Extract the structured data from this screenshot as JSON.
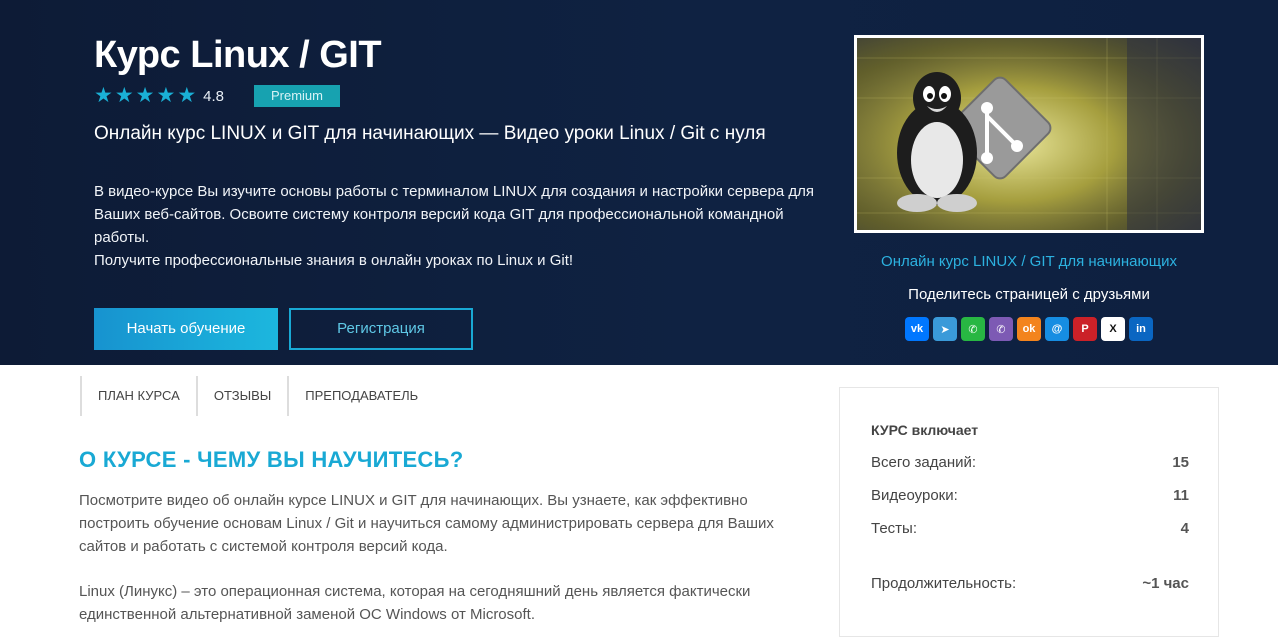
{
  "hero": {
    "title": "Курс Linux / GIT",
    "rating_value": "4.8",
    "premium_label": "Premium",
    "subtitle": "Онлайн курс LINUX и GIT для начинающих — Видео уроки Linux / Git с нуля",
    "description": "В видео-курсе Вы изучите основы работы с терминалом LINUX для создания и настройки сервера для Ваших веб-сайтов. Освоите систему контроля версий кода GIT для профессиональной командной работы.",
    "description2": "Получите профессиональные знания в онлайн уроках по Linux и Git!",
    "start_button": "Начать обучение",
    "register_button": "Регистрация"
  },
  "sidebar": {
    "image_link": "Онлайн курс LINUX / GIT для начинающих",
    "share_label": "Поделитесь страницей с друзьями",
    "share_buttons": [
      {
        "name": "vk",
        "glyph": "vk",
        "color": "#0077ff"
      },
      {
        "name": "telegram",
        "glyph": "➤",
        "color": "#3a9ad9"
      },
      {
        "name": "whatsapp",
        "glyph": "✆",
        "color": "#28b743"
      },
      {
        "name": "viber",
        "glyph": "✆",
        "color": "#7d5ab4"
      },
      {
        "name": "odnoklassniki",
        "glyph": "ok",
        "color": "#f3841d"
      },
      {
        "name": "moimir",
        "glyph": "@",
        "color": "#168de2"
      },
      {
        "name": "pinterest",
        "glyph": "P",
        "color": "#cb2128"
      },
      {
        "name": "x",
        "glyph": "X",
        "color": "#ffffff"
      },
      {
        "name": "linkedin",
        "glyph": "in",
        "color": "#0a66c2"
      }
    ]
  },
  "tabs": [
    "ПЛАН КУРСА",
    "ОТЗЫВЫ",
    "ПРЕПОДАВАТЕЛЬ"
  ],
  "about": {
    "heading": "О КУРСЕ - ЧЕМУ ВЫ НАУЧИТЕСЬ?",
    "paragraph1": "Посмотрите видео об онлайн курсе LINUX и GIT для начинающих. Вы узнаете, как эффективно построить обучение основам Linux / Git и научиться самому администрировать сервера для Ваших сайтов и работать с системой контроля версий кода.",
    "paragraph2": "Linux (Линукс) – это операционная система, которая на сегодняшний день является фактически единственной альтернативной заменой ОС Windows от Microsoft."
  },
  "includes": {
    "title": "КУРС включает",
    "rows": [
      {
        "label": "Всего заданий:",
        "value": "15"
      },
      {
        "label": "Видеоуроки:",
        "value": "11"
      },
      {
        "label": "Тесты:",
        "value": "4"
      },
      {
        "label": "Продолжительность:",
        "value": "~1 час"
      }
    ]
  },
  "colors": {
    "accent": "#19a9d4",
    "hero_bg": "#0f2242",
    "premium": "#17a2b0"
  }
}
